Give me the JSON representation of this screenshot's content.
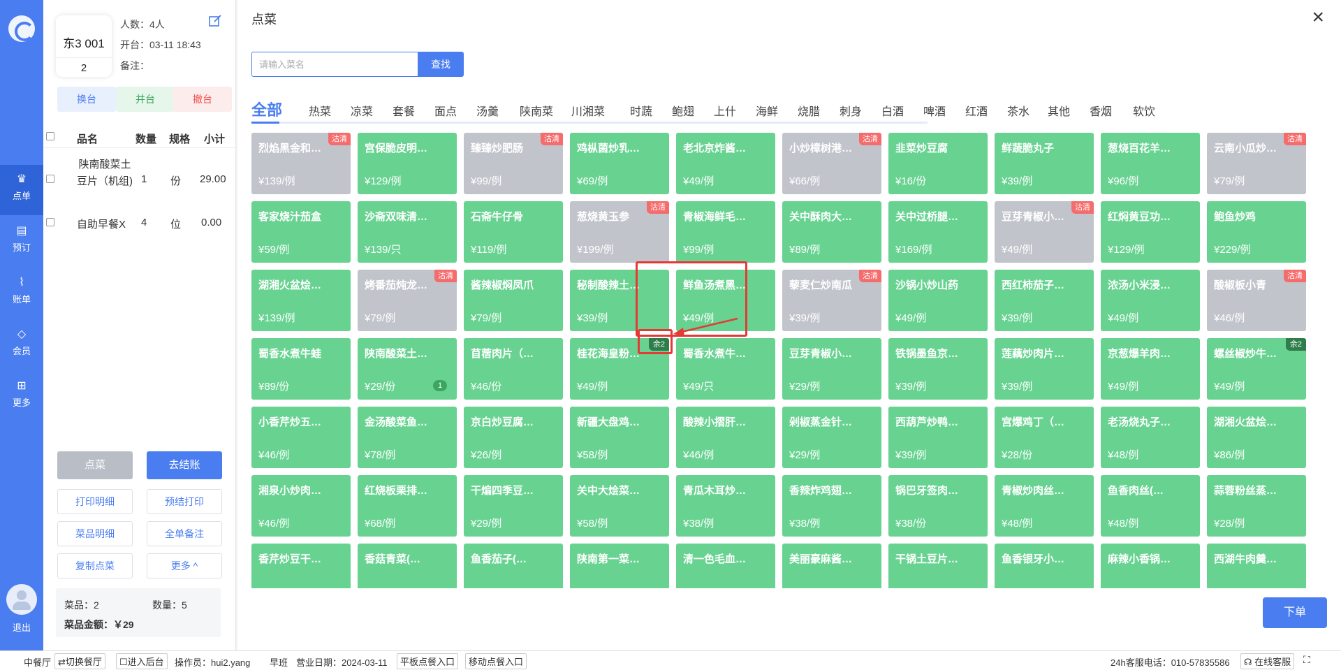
{
  "nav": {
    "items": [
      {
        "label": "点单",
        "icon": "chef-hat-icon",
        "active": true
      },
      {
        "label": "预订",
        "icon": "calendar-icon",
        "active": false
      },
      {
        "label": "账单",
        "icon": "chart-icon",
        "active": false
      },
      {
        "label": "会员",
        "icon": "diamond-icon",
        "active": false
      },
      {
        "label": "更多",
        "icon": "grid-icon",
        "active": false
      }
    ],
    "exit_label": "退出"
  },
  "order": {
    "table_name": "东3 001",
    "table_number": "2",
    "people": "人数：4人",
    "open_time": "开台：03-11 18:43",
    "note": "备注：",
    "actions": [
      "换台",
      "并台",
      "撤台"
    ],
    "headers": {
      "name": "品名",
      "qty": "数量",
      "spec": "规格",
      "subtotal": "小计"
    },
    "items": [
      {
        "name": "陕南酸菜土豆片（机组)",
        "qty": "1",
        "spec": "份",
        "subtotal": "29.00"
      },
      {
        "name": "自助早餐X",
        "qty": "4",
        "spec": "位",
        "subtotal": "0.00"
      }
    ],
    "buttons": {
      "order": "点菜",
      "checkout": "去结账",
      "print_detail": "打印明细",
      "pre_print": "预结打印",
      "dish_detail": "菜品明细",
      "order_note": "全单备注",
      "copy": "复制点菜",
      "more": "更多 ^"
    },
    "summary": {
      "dishes": "菜品：2",
      "quantity": "数量：5",
      "amount": "菜品金额：￥29"
    }
  },
  "main": {
    "title": "点菜",
    "search_placeholder": "请输入菜名",
    "search_button": "查找",
    "categories": [
      "全部",
      "热菜",
      "凉菜",
      "套餐",
      "面点",
      "汤羹",
      "陕南菜",
      "川湘菜",
      "时蔬",
      "鲍翅",
      "上什",
      "海鲜",
      "烧腊",
      "刺身",
      "白酒",
      "啤酒",
      "红酒",
      "茶水",
      "其他",
      "香烟",
      "软饮"
    ],
    "sold_out_label": "沽清",
    "remaining_label": "余2",
    "dishes": [
      {
        "name": "烈焰黑金和…",
        "price": "¥139/例",
        "sold_out": true
      },
      {
        "name": "宫保脆皮明…",
        "price": "¥129/例"
      },
      {
        "name": "臻臻炒肥肠",
        "price": "¥99/例",
        "sold_out": true
      },
      {
        "name": "鸡枞菌炒乳…",
        "price": "¥69/例"
      },
      {
        "name": "老北京炸酱…",
        "price": "¥49/例"
      },
      {
        "name": "小炒樟树港…",
        "price": "¥66/例",
        "sold_out": true
      },
      {
        "name": "韭菜炒豆腐",
        "price": "¥16/份"
      },
      {
        "name": "鲜蔬脆丸子",
        "price": "¥39/例"
      },
      {
        "name": "葱烧百花羊…",
        "price": "¥96/例"
      },
      {
        "name": "云南小瓜炒…",
        "price": "¥79/例",
        "sold_out": true
      },
      {
        "name": "客家烧汁茄盒",
        "price": "¥59/例"
      },
      {
        "name": "沙斋双味清…",
        "price": "¥139/只"
      },
      {
        "name": "石斋牛仔骨",
        "price": "¥119/例"
      },
      {
        "name": "葱烧黄玉参",
        "price": "¥199/例",
        "sold_out": true
      },
      {
        "name": "青椒海鲜毛…",
        "price": "¥99/例"
      },
      {
        "name": "关中酥肉大…",
        "price": "¥89/例"
      },
      {
        "name": "关中过桥腿…",
        "price": "¥169/例"
      },
      {
        "name": "豆芽青椒小…",
        "price": "¥49/例",
        "sold_out": true
      },
      {
        "name": "红焖黄豆功…",
        "price": "¥129/例"
      },
      {
        "name": "鲍鱼炒鸡",
        "price": "¥229/例"
      },
      {
        "name": "湖湘火盆烩…",
        "price": "¥139/例"
      },
      {
        "name": "烤番茄炖龙…",
        "price": "¥79/例",
        "sold_out": true
      },
      {
        "name": "酱辣椒焖凤爪",
        "price": "¥79/例"
      },
      {
        "name": "秘制酸辣土…",
        "price": "¥39/例"
      },
      {
        "name": "鲜鱼汤煮黑…",
        "price": "¥49/例"
      },
      {
        "name": "藜麦仁炒南瓜",
        "price": "¥39/例",
        "sold_out": true,
        "highlight": true
      },
      {
        "name": "沙锅小炒山药",
        "price": "¥49/例"
      },
      {
        "name": "西红柿茄子…",
        "price": "¥39/例"
      },
      {
        "name": "浓汤小米浸…",
        "price": "¥49/例"
      },
      {
        "name": "酸椒板小青",
        "price": "¥46/例",
        "sold_out": true
      },
      {
        "name": "蜀香水煮牛蛙",
        "price": "¥89/份"
      },
      {
        "name": "陕南酸菜土…",
        "price": "¥29/份",
        "count": "1"
      },
      {
        "name": "苜蓿肉片（…",
        "price": "¥46/份"
      },
      {
        "name": "桂花海皇粉…",
        "price": "¥49/例",
        "remaining": true
      },
      {
        "name": "蜀香水煮牛…",
        "price": "¥49/只"
      },
      {
        "name": "豆芽青椒小…",
        "price": "¥29/例"
      },
      {
        "name": "铁锅墨鱼京…",
        "price": "¥39/例"
      },
      {
        "name": "莲藕炒肉片…",
        "price": "¥39/例"
      },
      {
        "name": "京葱爆羊肉…",
        "price": "¥49/例"
      },
      {
        "name": "螺丝椒炒牛…",
        "price": "¥49/例",
        "remaining": true
      },
      {
        "name": "小香芹炒五…",
        "price": "¥46/例"
      },
      {
        "name": "金汤酸菜鱼…",
        "price": "¥78/例"
      },
      {
        "name": "京白炒豆腐…",
        "price": "¥26/例"
      },
      {
        "name": "新疆大盘鸡…",
        "price": "¥58/例"
      },
      {
        "name": "酸辣小摺肝…",
        "price": "¥46/例"
      },
      {
        "name": "剁椒蒸金针…",
        "price": "¥29/例"
      },
      {
        "name": "西葫芦炒鸭…",
        "price": "¥39/例"
      },
      {
        "name": "宫爆鸡丁（…",
        "price": "¥28/份"
      },
      {
        "name": "老汤烧丸子…",
        "price": "¥48/例"
      },
      {
        "name": "湖湘火盆烩…",
        "price": "¥86/例"
      },
      {
        "name": "湘泉小炒肉…",
        "price": "¥46/例"
      },
      {
        "name": "红烧板栗排…",
        "price": "¥68/例"
      },
      {
        "name": "干煸四季豆…",
        "price": "¥29/例"
      },
      {
        "name": "关中大烩菜…",
        "price": "¥58/例"
      },
      {
        "name": "青瓜木耳炒…",
        "price": "¥38/例"
      },
      {
        "name": "香辣炸鸡翅…",
        "price": "¥38/例"
      },
      {
        "name": "锅巴牙签肉…",
        "price": "¥38/份"
      },
      {
        "name": "青椒炒肉丝…",
        "price": "¥48/例"
      },
      {
        "name": "鱼香肉丝(…",
        "price": "¥48/例"
      },
      {
        "name": "蒜蓉粉丝蒸…",
        "price": "¥28/例"
      },
      {
        "name": "香芹炒豆干…",
        "price": ""
      },
      {
        "name": "香菇青菜(…",
        "price": ""
      },
      {
        "name": "鱼香茄子(…",
        "price": ""
      },
      {
        "name": "陕南第一菜…",
        "price": ""
      },
      {
        "name": "清一色毛血…",
        "price": ""
      },
      {
        "name": "美丽豪麻酱…",
        "price": ""
      },
      {
        "name": "干锅土豆片…",
        "price": ""
      },
      {
        "name": "鱼香银牙小…",
        "price": ""
      },
      {
        "name": "麻辣小香锅…",
        "price": ""
      },
      {
        "name": "西湖牛肉羹…",
        "price": ""
      }
    ],
    "submit": "下单"
  },
  "status": {
    "hall": "中餐厅",
    "switch": "⇄切换餐厅",
    "backend": "☐进入后台",
    "operator": "操作员：hui2.yang",
    "shift": "早班",
    "business_date": "营业日期：2024-03-11",
    "tablet": "平板点餐入口",
    "mobile": "移动点餐入口",
    "hotline": "24h客服电话：010-57835586",
    "online": "在线客服"
  }
}
